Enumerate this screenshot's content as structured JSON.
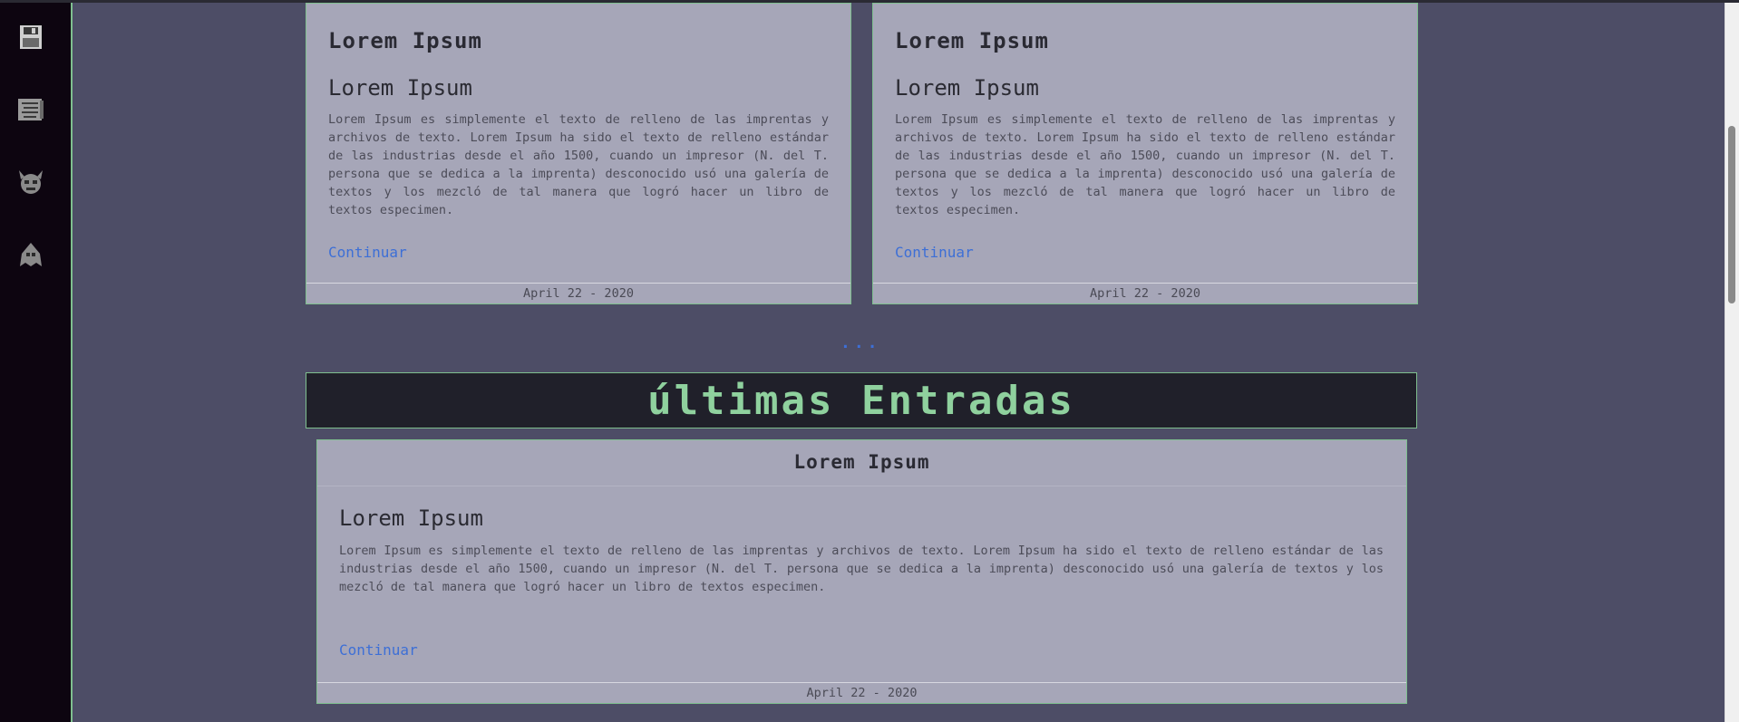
{
  "sidebar": {
    "icons": [
      {
        "name": "floppy-disk-icon"
      },
      {
        "name": "scroll-icon"
      },
      {
        "name": "demon-face-icon"
      },
      {
        "name": "ghost-icon"
      }
    ]
  },
  "top_cards": [
    {
      "title": "Lorem Ipsum",
      "subtitle": "Lorem Ipsum",
      "body": "Lorem Ipsum es simplemente el texto de relleno de las imprentas y archivos de texto. Lorem Ipsum ha sido el texto de relleno estándar de las industrias desde el año 1500, cuando un impresor (N. del T. persona que se dedica a la imprenta) desconocido usó una galería de textos y los mezcló de tal manera que logró hacer un libro de textos especimen.",
      "link": "Continuar",
      "date": "April 22 - 2020"
    },
    {
      "title": "Lorem Ipsum",
      "subtitle": "Lorem Ipsum",
      "body": "Lorem Ipsum es simplemente el texto de relleno de las imprentas y archivos de texto. Lorem Ipsum ha sido el texto de relleno estándar de las industrias desde el año 1500, cuando un impresor (N. del T. persona que se dedica a la imprenta) desconocido usó una galería de textos y los mezcló de tal manera que logró hacer un libro de textos especimen.",
      "link": "Continuar",
      "date": "April 22 - 2020"
    }
  ],
  "more_dots": "...",
  "latest": {
    "heading": "últimas Entradas",
    "card": {
      "title": "Lorem Ipsum",
      "subtitle": "Lorem Ipsum",
      "body": "Lorem Ipsum es simplemente el texto de relleno de las imprentas y archivos de texto. Lorem Ipsum ha sido el texto de relleno estándar de las industrias desde el año 1500, cuando un impresor (N. del T. persona que se dedica a la imprenta) desconocido usó una galería de textos y los mezcló de tal manera que logró hacer un libro de textos especimen.",
      "link": "Continuar",
      "date": "April 22 - 2020"
    }
  },
  "colors": {
    "page_bg": "#4d4d66",
    "card_bg": "#a6a6b8",
    "border": "#7fbf8f",
    "link": "#3d6fd6",
    "banner_bg": "#20202a",
    "banner_text": "#8fd19e",
    "sidebar_bg": "#0d0510"
  }
}
